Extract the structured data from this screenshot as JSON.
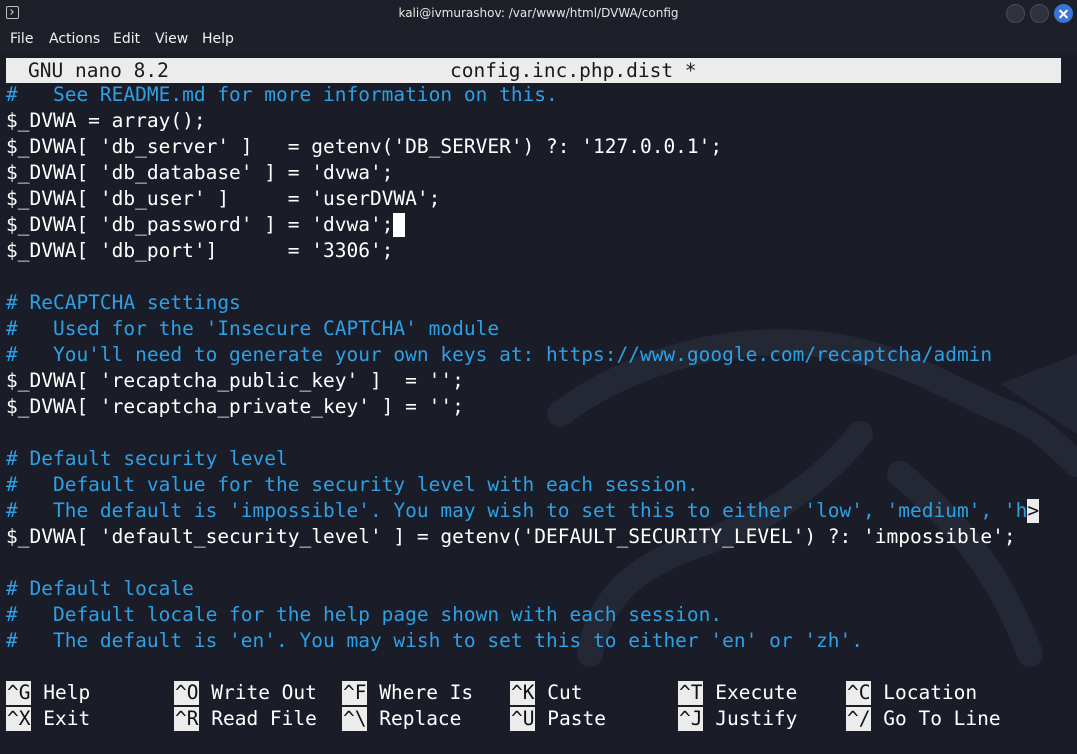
{
  "window": {
    "title": "kali@ivmurashov: /var/www/html/DVWA/config",
    "icon": "terminal-icon",
    "controls": [
      "minimize-icon",
      "maximize-icon",
      "close-icon"
    ],
    "accent": "#3b73d9"
  },
  "menu": [
    "File",
    "Actions",
    "Edit",
    "View",
    "Help"
  ],
  "nano": {
    "version": "GNU nano 8.2",
    "filename": "config.inc.php.dist *"
  },
  "editor": {
    "lines": [
      {
        "text": "#   See README.md for more information on this.",
        "kind": "comment"
      },
      {
        "text": "$_DVWA = array();",
        "kind": "code"
      },
      {
        "text": "$_DVWA[ 'db_server' ]   = getenv('DB_SERVER') ?: '127.0.0.1';",
        "kind": "code"
      },
      {
        "text": "$_DVWA[ 'db_database' ] = 'dvwa';",
        "kind": "code"
      },
      {
        "text": "$_DVWA[ 'db_user' ]     = 'userDVWA';",
        "kind": "code"
      },
      {
        "text": "$_DVWA[ 'db_password' ] = 'dvwa';",
        "kind": "code",
        "cursor": true
      },
      {
        "text": "$_DVWA[ 'db_port']      = '3306';",
        "kind": "code"
      },
      {
        "text": "",
        "kind": "blank"
      },
      {
        "text": "# ReCAPTCHA settings",
        "kind": "comment"
      },
      {
        "text": "#   Used for the 'Insecure CAPTCHA' module",
        "kind": "comment"
      },
      {
        "text": "#   You'll need to generate your own keys at: https://www.google.com/recaptcha/admin",
        "kind": "comment"
      },
      {
        "text": "$_DVWA[ 'recaptcha_public_key' ]  = '';",
        "kind": "code"
      },
      {
        "text": "$_DVWA[ 'recaptcha_private_key' ] = '';",
        "kind": "code"
      },
      {
        "text": "",
        "kind": "blank"
      },
      {
        "text": "# Default security level",
        "kind": "comment"
      },
      {
        "text": "#   Default value for the security level with each session.",
        "kind": "comment"
      },
      {
        "text": "#   The default is 'impossible'. You may wish to set this to either 'low', 'medium', 'h",
        "kind": "comment",
        "overflow": ">"
      },
      {
        "text": "$_DVWA[ 'default_security_level' ] = getenv('DEFAULT_SECURITY_LEVEL') ?: 'impossible';",
        "kind": "code"
      },
      {
        "text": "",
        "kind": "blank"
      },
      {
        "text": "# Default locale",
        "kind": "comment"
      },
      {
        "text": "#   Default locale for the help page shown with each session.",
        "kind": "comment"
      },
      {
        "text": "#   The default is 'en'. You may wish to set this to either 'en' or 'zh'.",
        "kind": "comment"
      }
    ]
  },
  "shortcuts": [
    [
      {
        "key": "^G",
        "label": "Help"
      },
      {
        "key": "^O",
        "label": "Write Out"
      },
      {
        "key": "^F",
        "label": "Where Is"
      },
      {
        "key": "^K",
        "label": "Cut"
      },
      {
        "key": "^T",
        "label": "Execute"
      },
      {
        "key": "^C",
        "label": "Location"
      }
    ],
    [
      {
        "key": "^X",
        "label": "Exit"
      },
      {
        "key": "^R",
        "label": "Read File"
      },
      {
        "key": "^\\",
        "label": "Replace"
      },
      {
        "key": "^U",
        "label": "Paste"
      },
      {
        "key": "^J",
        "label": "Justify"
      },
      {
        "key": "^/",
        "label": "Go To Line"
      }
    ]
  ],
  "colors": {
    "background": "#1a1d27",
    "comment": "#2ea0e6",
    "text": "#ffffff",
    "nano_header_bg": "#ececec"
  }
}
